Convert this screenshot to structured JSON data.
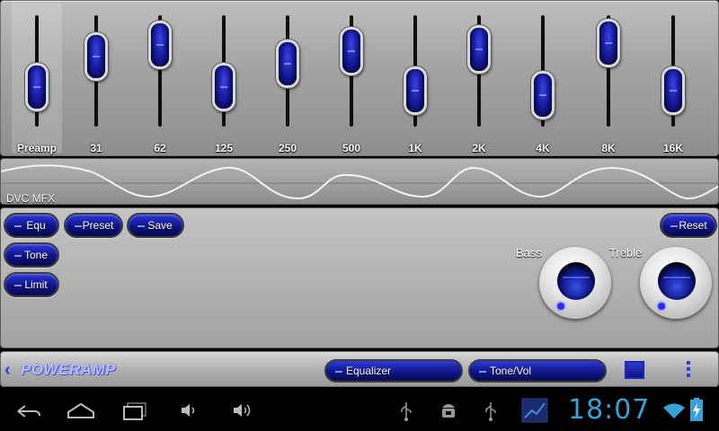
{
  "equalizer": {
    "bands": [
      {
        "label": "Preamp",
        "level": 0.25
      },
      {
        "label": "31",
        "level": 0.73
      },
      {
        "label": "62",
        "level": 0.92
      },
      {
        "label": "125",
        "level": 0.25
      },
      {
        "label": "250",
        "level": 0.62
      },
      {
        "label": "500",
        "level": 0.81
      },
      {
        "label": "1K",
        "level": 0.19
      },
      {
        "label": "2K",
        "level": 0.85
      },
      {
        "label": "4K",
        "level": 0.12
      },
      {
        "label": "8K",
        "level": 0.94
      },
      {
        "label": "16K",
        "level": 0.19
      }
    ]
  },
  "wave": {
    "label": "DVC MFX"
  },
  "controls": {
    "equ_label": "Equ",
    "preset_label": "Preset",
    "save_label": "Save",
    "tone_label": "Tone",
    "limit_label": "Limit",
    "reset_label": "Reset",
    "bass_label": "Bass",
    "treble_label": "Treble"
  },
  "app_bar": {
    "logo_text": "POWERAMP",
    "equalizer_tab": "Equalizer",
    "tonevol_tab": "Tone/Vol"
  },
  "system_bar": {
    "clock": "18:07"
  },
  "colors": {
    "accent_blue": "#1a1fa8",
    "clock_blue": "#3aa0d8"
  }
}
